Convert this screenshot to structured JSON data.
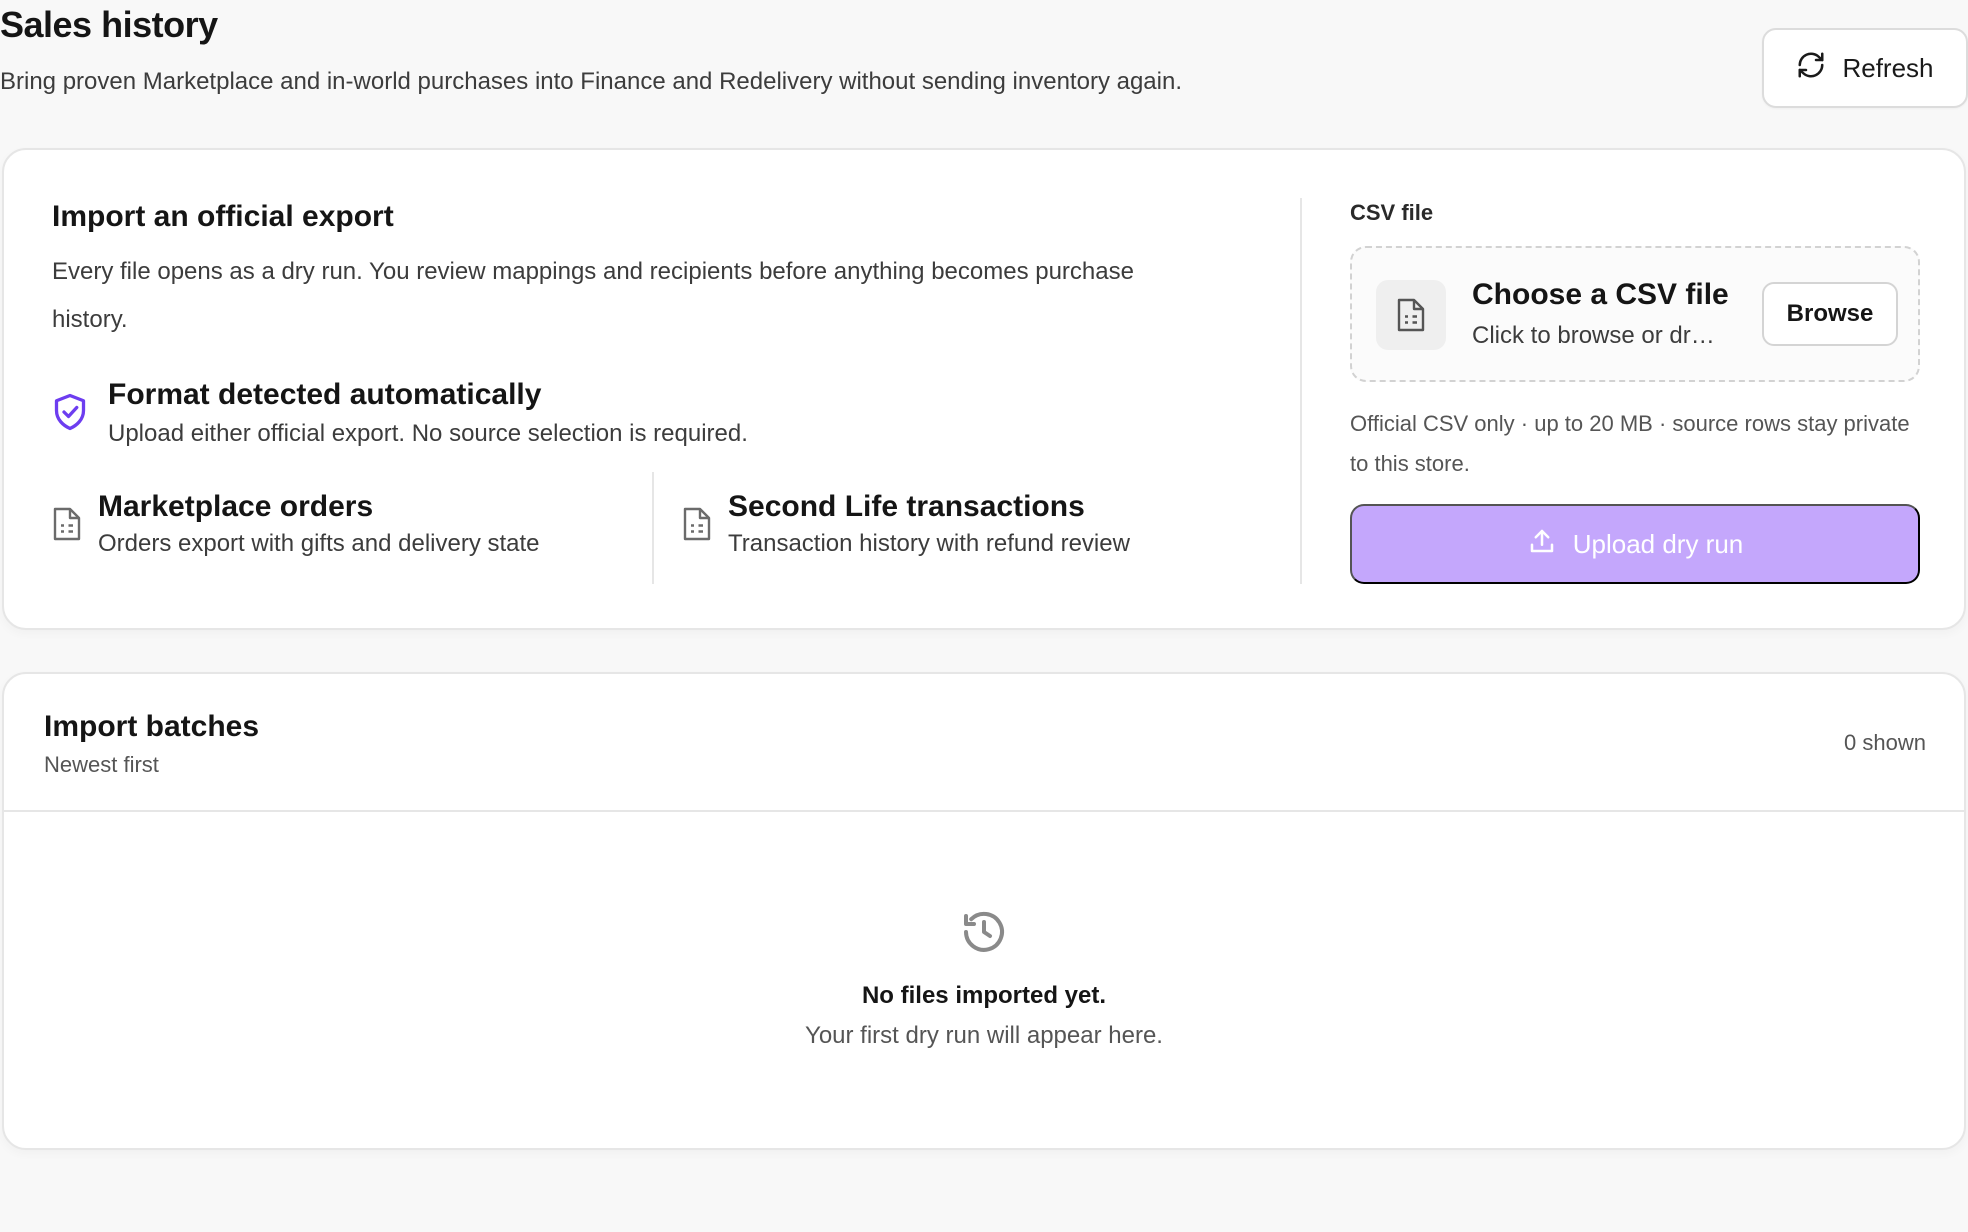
{
  "header": {
    "title": "Sales history",
    "subtitle": "Bring proven Marketplace and in-world purchases into Finance and Redelivery without sending inventory again.",
    "refresh_label": "Refresh"
  },
  "import": {
    "title": "Import an official export",
    "description": "Every file opens as a dry run. You review mappings and recipients before anything becomes purchase history.",
    "format": {
      "title": "Format detected automatically",
      "subtitle": "Upload either official export. No source selection is required."
    },
    "sources": [
      {
        "title": "Marketplace orders",
        "subtitle": "Orders export with gifts and delivery state"
      },
      {
        "title": "Second Life transactions",
        "subtitle": "Transaction history with refund review"
      }
    ],
    "csv": {
      "label": "CSV file",
      "choose_title": "Choose a CSV file",
      "choose_subtitle": "Click to browse or drag a file here",
      "browse_label": "Browse",
      "hint": "Official CSV only · up to 20 MB · source rows stay private to this store.",
      "upload_label": "Upload dry run"
    }
  },
  "batches": {
    "title": "Import batches",
    "subtitle": "Newest first",
    "count_label": "0 shown",
    "empty_title": "No files imported yet.",
    "empty_subtitle": "Your first dry run will appear here."
  },
  "colors": {
    "accent": "#6d3df0",
    "upload_button_disabled": "#c4a7fc",
    "background": "#f8f8f8",
    "card_border": "#e6e6e6"
  },
  "icons": {
    "refresh": "refresh-icon",
    "shield": "shield-check-icon",
    "file": "file-spreadsheet-icon",
    "upload": "upload-icon",
    "history": "history-icon"
  }
}
